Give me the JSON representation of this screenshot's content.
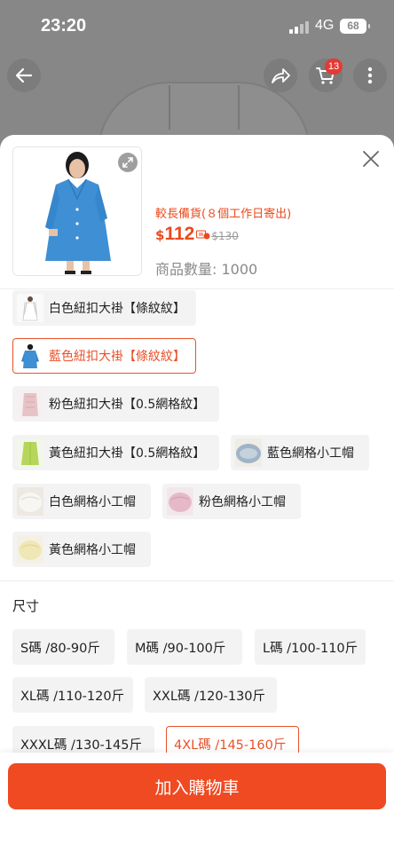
{
  "status_bar": {
    "time": "23:20",
    "network": "4G",
    "battery": "68"
  },
  "header": {
    "cart_count": "13"
  },
  "product": {
    "stock_note": "較長備貨(８個工作日寄出)",
    "currency": "$",
    "price": "112",
    "original_price": "$130",
    "quantity_text": "商品數量: 1000"
  },
  "options": {
    "colors": [
      {
        "label": "白色紐扣大褂【條紋紋】",
        "selected": false,
        "swatch": "white-coat"
      },
      {
        "label": "藍色紐扣大褂【條紋紋】",
        "selected": true,
        "swatch": "blue-coat"
      },
      {
        "label": "粉色紐扣大褂【0.5網格紋】",
        "selected": false,
        "swatch": "pink-coat"
      },
      {
        "label": "黃色紐扣大褂【0.5網格紋】",
        "selected": false,
        "swatch": "yellow-coat"
      },
      {
        "label": "藍色網格小工帽",
        "selected": false,
        "swatch": "blue-cap"
      },
      {
        "label": "白色網格小工帽",
        "selected": false,
        "swatch": "white-cap"
      },
      {
        "label": "粉色網格小工帽",
        "selected": false,
        "swatch": "pink-cap"
      },
      {
        "label": "黃色網格小工帽",
        "selected": false,
        "swatch": "yellow-cap"
      }
    ],
    "size_title": "尺寸",
    "sizes": [
      {
        "label": "S碼  /80-90斤",
        "selected": false
      },
      {
        "label": "M碼   /90-100斤",
        "selected": false
      },
      {
        "label": "L碼  /100-110斤",
        "selected": false
      },
      {
        "label": "XL碼  /110-120斤",
        "selected": false
      },
      {
        "label": "XXL碼  /120-130斤",
        "selected": false
      },
      {
        "label": "XXXL碼  /130-145斤",
        "selected": false
      },
      {
        "label": "4XL碼  /145-160斤",
        "selected": true
      }
    ]
  },
  "actions": {
    "add_to_cart": "加入購物車"
  },
  "colors": {
    "accent": "#ef4a22",
    "price": "#ea4a1c",
    "chip_bg": "#f3f3f3"
  }
}
